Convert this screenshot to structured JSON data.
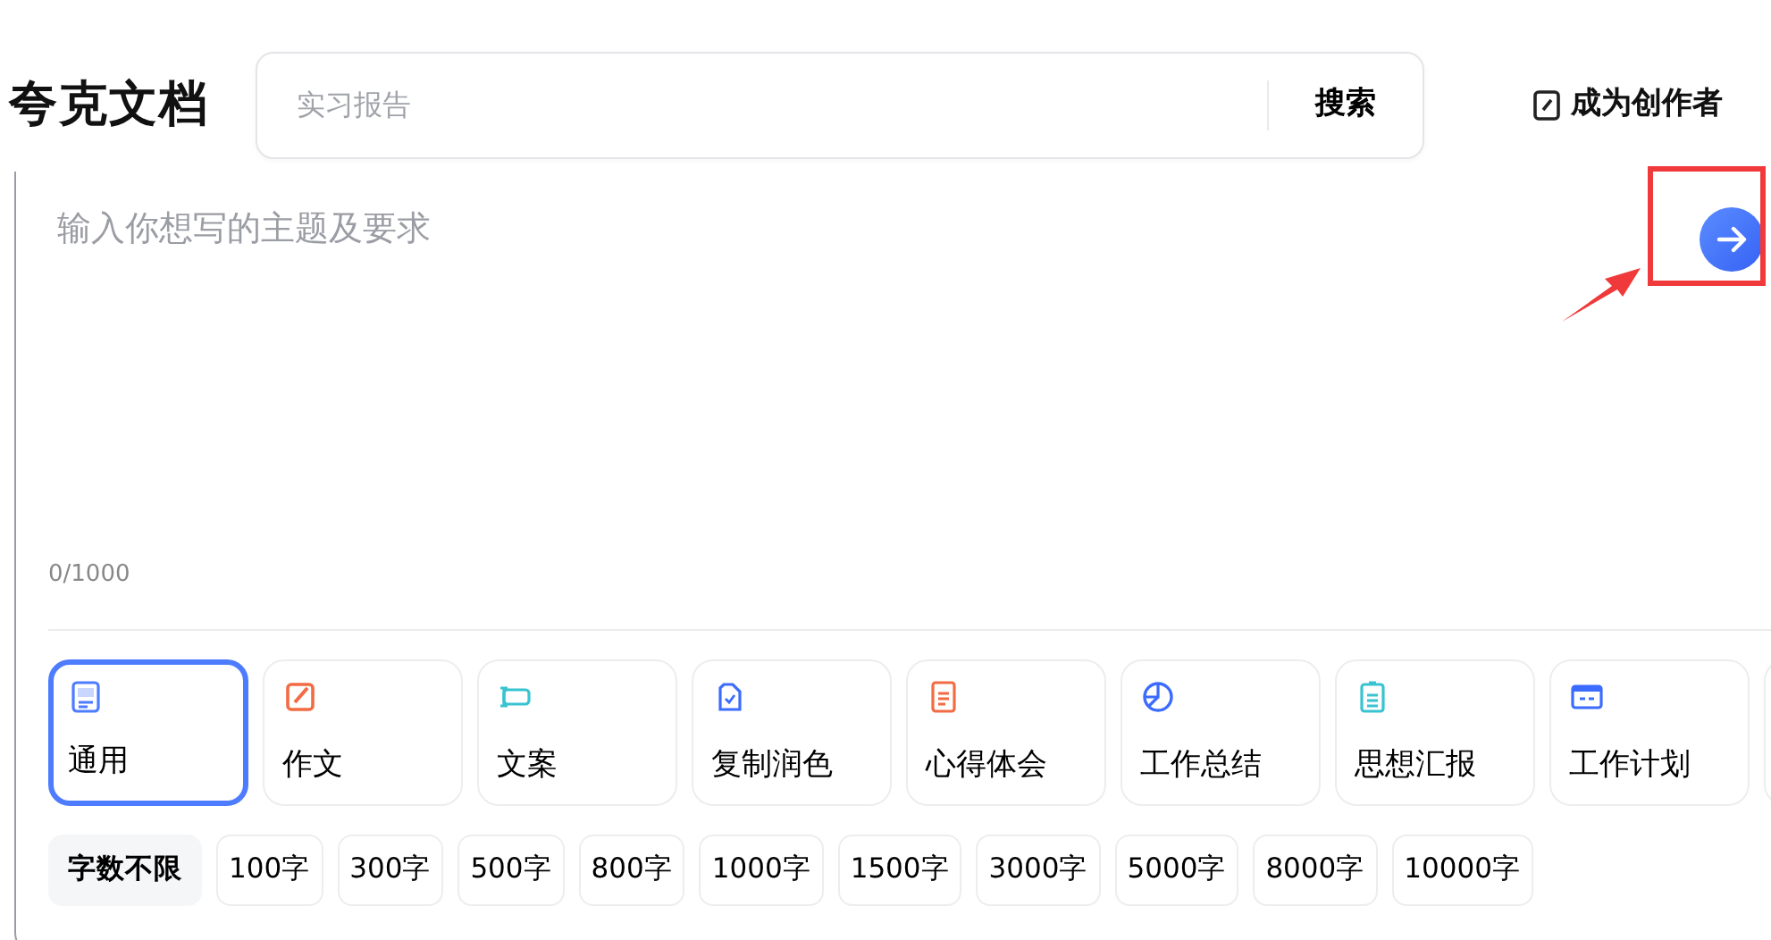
{
  "logo": "夸克文档",
  "search": {
    "placeholder": "实习报告",
    "button": "搜索"
  },
  "creator_link": "成为创作者",
  "prompt": {
    "placeholder": "输入你想写的主题及要求",
    "counter": "0/1000"
  },
  "categories": [
    {
      "label": "通用",
      "selected": true
    },
    {
      "label": "作文",
      "selected": false
    },
    {
      "label": "文案",
      "selected": false
    },
    {
      "label": "复制润色",
      "selected": false
    },
    {
      "label": "心得体会",
      "selected": false
    },
    {
      "label": "工作总结",
      "selected": false
    },
    {
      "label": "思想汇报",
      "selected": false
    },
    {
      "label": "工作计划",
      "selected": false
    }
  ],
  "lengths": [
    {
      "label": "字数不限",
      "selected": true
    },
    {
      "label": "100字",
      "selected": false
    },
    {
      "label": "300字",
      "selected": false
    },
    {
      "label": "500字",
      "selected": false
    },
    {
      "label": "800字",
      "selected": false
    },
    {
      "label": "1000字",
      "selected": false
    },
    {
      "label": "1500字",
      "selected": false
    },
    {
      "label": "3000字",
      "selected": false
    },
    {
      "label": "5000字",
      "selected": false
    },
    {
      "label": "8000字",
      "selected": false
    },
    {
      "label": "10000字",
      "selected": false
    }
  ]
}
